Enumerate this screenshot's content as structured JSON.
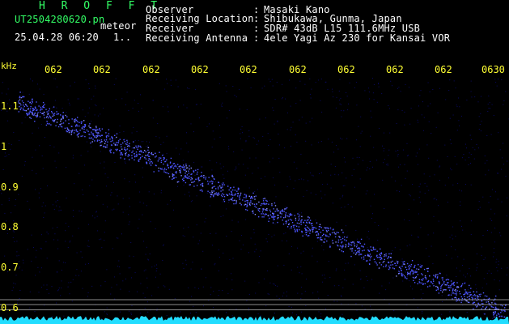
{
  "header": {
    "brand": "H R O F F T",
    "file_name": "UT2504280620.pn",
    "file_tag": "meteor",
    "date_time": "25.04.28 06:20",
    "counter": "1..",
    "fields": [
      {
        "label": "Observer",
        "value": "Masaki Kano"
      },
      {
        "label": "Receiving Location",
        "value": "Shibukawa, Gunma, Japan"
      },
      {
        "label": "Receiver",
        "value": "SDR# 43dB L15 111.6MHz USB"
      },
      {
        "label": "Receiving Antenna",
        "value": "4ele Yagi Az 230 for Kansai VOR"
      }
    ],
    "separator": ":"
  },
  "chart_data": {
    "type": "heatmap",
    "ylabel": "kHz",
    "x_tick_labels": [
      "062",
      "062",
      "062",
      "062",
      "062",
      "062",
      "062",
      "062",
      "062",
      "0630"
    ],
    "y_ticks": [
      1.1,
      1.0,
      0.9,
      0.8,
      0.7,
      0.6
    ],
    "ylim": [
      0.58,
      1.16
    ],
    "trace": {
      "start_min": 0,
      "start_khz": 1.11,
      "end_min": 10,
      "end_khz": 0.59
    },
    "reference_lines_khz": [
      0.62,
      0.608,
      0.595
    ],
    "colors": {
      "trace": "#4d55ff",
      "noise": "#0a0a66",
      "baseline": "#22ddff",
      "tick": "#ffff33",
      "ref_line": "#bbbbbb"
    }
  }
}
